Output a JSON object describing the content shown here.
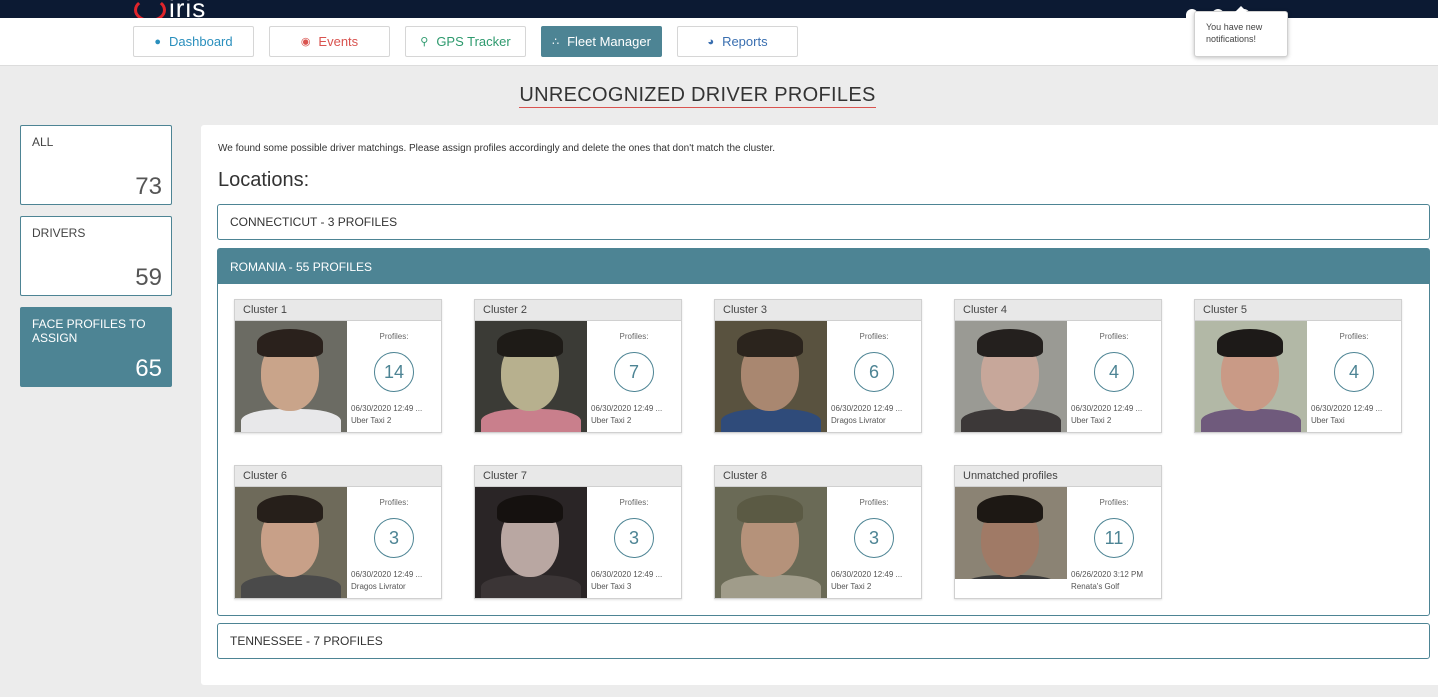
{
  "header": {
    "logo_text": "iris",
    "notification_tooltip": "You have new notifications!"
  },
  "nav": {
    "items": [
      {
        "label": "Dashboard",
        "icon": "dashboard-icon"
      },
      {
        "label": "Events",
        "icon": "record-icon"
      },
      {
        "label": "GPS Tracker",
        "icon": "map-pin-icon"
      },
      {
        "label": "Fleet Manager",
        "icon": "fleet-icon",
        "active": true
      },
      {
        "label": "Reports",
        "icon": "pie-chart-icon"
      }
    ]
  },
  "page_title": "UNRECOGNIZED DRIVER PROFILES",
  "stats": [
    {
      "label": "ALL",
      "value": "73"
    },
    {
      "label": "DRIVERS",
      "value": "59"
    },
    {
      "label": "FACE PROFILES TO ASSIGN",
      "value": "65",
      "active": true
    }
  ],
  "main": {
    "intro": "We found some possible driver matchings. Please assign profiles accordingly and delete the ones that don't match the cluster.",
    "locations_heading": "Locations:",
    "locations": [
      {
        "label": "CONNECTICUT - 3 PROFILES"
      },
      {
        "label": "ROMANIA - 55 PROFILES"
      },
      {
        "label": "TENNESSEE - 7 PROFILES"
      }
    ]
  },
  "clusters": [
    {
      "title": "Cluster 1",
      "profiles_label": "Profiles:",
      "count": "14",
      "date": "06/30/2020 12:49 ...",
      "vehicle": "Uber Taxi 2"
    },
    {
      "title": "Cluster 2",
      "profiles_label": "Profiles:",
      "count": "7",
      "date": "06/30/2020 12:49 ...",
      "vehicle": "Uber Taxi 2"
    },
    {
      "title": "Cluster 3",
      "profiles_label": "Profiles:",
      "count": "6",
      "date": "06/30/2020 12:49 ...",
      "vehicle": "Dragos Livrator"
    },
    {
      "title": "Cluster 4",
      "profiles_label": "Profiles:",
      "count": "4",
      "date": "06/30/2020 12:49 ...",
      "vehicle": "Uber Taxi 2"
    },
    {
      "title": "Cluster 5",
      "profiles_label": "Profiles:",
      "count": "4",
      "date": "06/30/2020 12:49 ...",
      "vehicle": "Uber Taxi"
    },
    {
      "title": "Cluster 6",
      "profiles_label": "Profiles:",
      "count": "3",
      "date": "06/30/2020 12:49 ...",
      "vehicle": "Dragos Livrator"
    },
    {
      "title": "Cluster 7",
      "profiles_label": "Profiles:",
      "count": "3",
      "date": "06/30/2020 12:49 ...",
      "vehicle": "Uber Taxi 3"
    },
    {
      "title": "Cluster 8",
      "profiles_label": "Profiles:",
      "count": "3",
      "date": "06/30/2020 12:49 ...",
      "vehicle": "Uber Taxi 2"
    },
    {
      "title": "Unmatched profiles",
      "profiles_label": "Profiles:",
      "count": "11",
      "date": "06/26/2020 3:12 PM",
      "vehicle": "Renata's Golf"
    }
  ],
  "colors": {
    "accent": "#4d8494",
    "header_bg": "#0c1a33",
    "title_underline": "#d9534f"
  }
}
